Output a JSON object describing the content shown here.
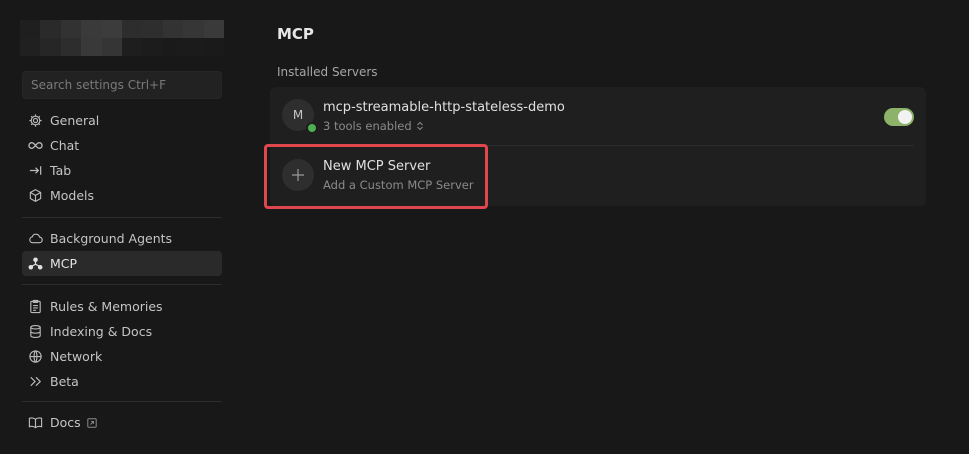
{
  "sidebar": {
    "search": {
      "placeholder": "Search settings Ctrl+F"
    },
    "group1": [
      {
        "label": "General",
        "icon": "gear-icon"
      },
      {
        "label": "Chat",
        "icon": "infinity-icon"
      },
      {
        "label": "Tab",
        "icon": "tab-arrow-icon"
      },
      {
        "label": "Models",
        "icon": "cube-icon"
      }
    ],
    "group2": [
      {
        "label": "Background Agents",
        "icon": "cloud-icon"
      },
      {
        "label": "MCP",
        "icon": "mcp-icon",
        "active": true
      }
    ],
    "group3": [
      {
        "label": "Rules & Memories",
        "icon": "clipboard-icon"
      },
      {
        "label": "Indexing & Docs",
        "icon": "database-icon"
      },
      {
        "label": "Network",
        "icon": "globe-icon"
      },
      {
        "label": "Beta",
        "icon": "double-chevron-icon"
      }
    ],
    "footer": {
      "label": "Docs",
      "icon": "book-icon"
    }
  },
  "main": {
    "title": "MCP",
    "section_label": "Installed Servers",
    "server": {
      "avatar_letter": "M",
      "name": "mcp-streamable-http-stateless-demo",
      "tools": "3 tools enabled",
      "enabled": true,
      "status_color": "#4caf50"
    },
    "new_server": {
      "title": "New MCP Server",
      "subtitle": "Add a Custom MCP Server"
    }
  },
  "colors": {
    "background": "#181818",
    "card": "#1f1f1f",
    "toggle_on": "#8db36a",
    "highlight": "#e0474c"
  }
}
